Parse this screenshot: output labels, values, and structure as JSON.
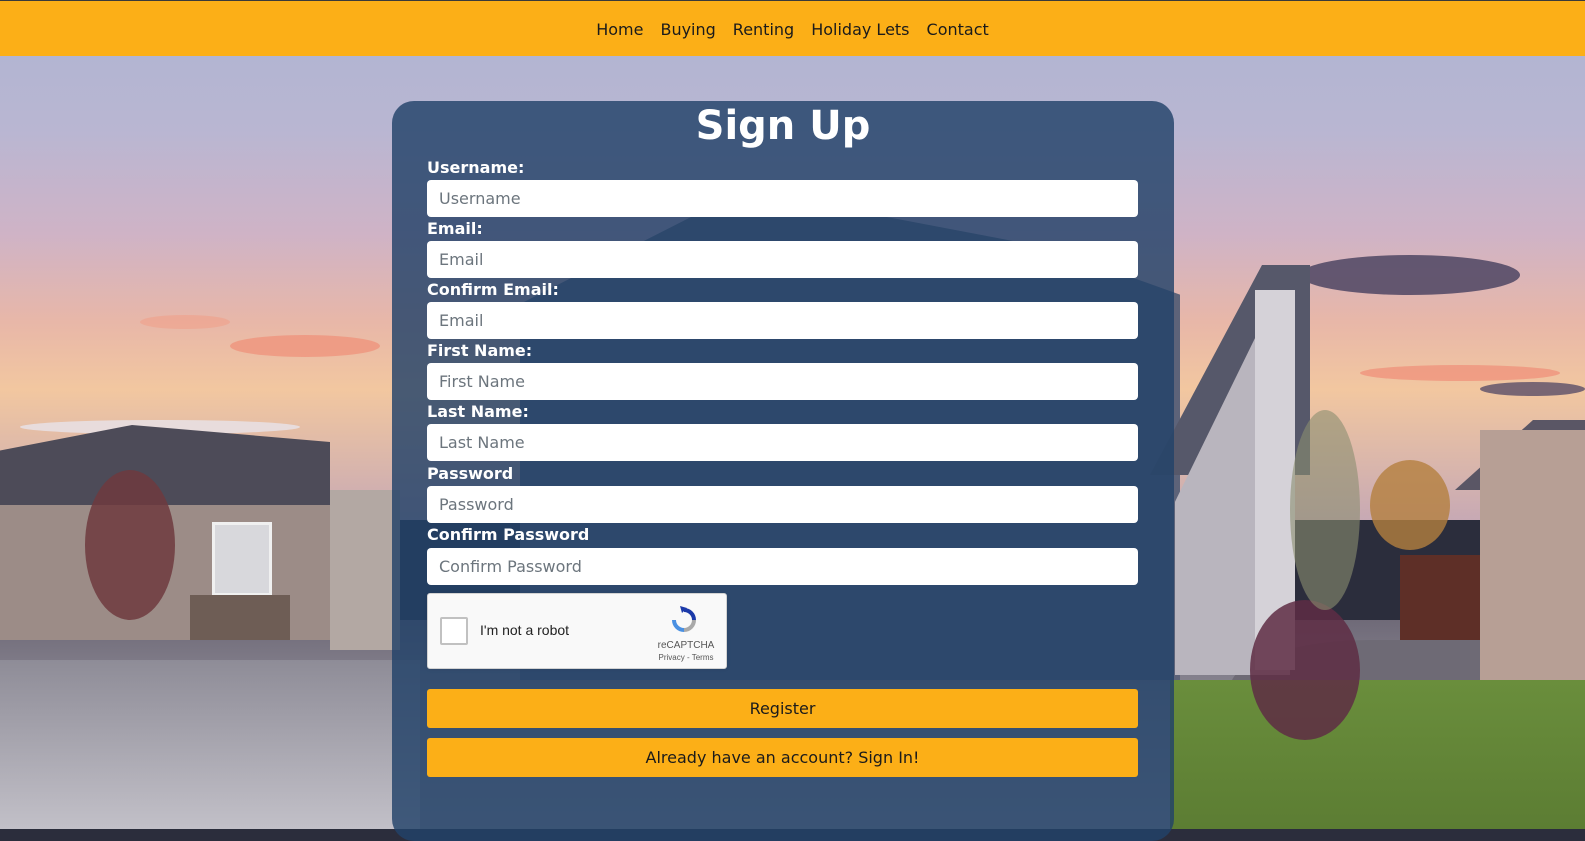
{
  "nav": {
    "items": [
      "Home",
      "Buying",
      "Renting",
      "Holiday Lets",
      "Contact"
    ]
  },
  "form": {
    "title": "Sign Up",
    "fields": [
      {
        "label": "Username:",
        "placeholder": "Username"
      },
      {
        "label": "Email:",
        "placeholder": "Email"
      },
      {
        "label": "Confirm Email:",
        "placeholder": "Email"
      },
      {
        "label": "First Name:",
        "placeholder": "First Name"
      },
      {
        "label": "Last Name:",
        "placeholder": "Last Name"
      },
      {
        "label": "Password",
        "placeholder": "Password"
      },
      {
        "label": "Confirm Password",
        "placeholder": "Confirm Password"
      }
    ],
    "captcha": {
      "label": "I'm not a robot",
      "brand": "reCAPTCHA",
      "terms": "Privacy - Terms"
    },
    "register_label": "Register",
    "signin_label": "Already have an account? Sign In!"
  },
  "colors": {
    "accent": "#fcaf17",
    "panel": "#224269"
  }
}
